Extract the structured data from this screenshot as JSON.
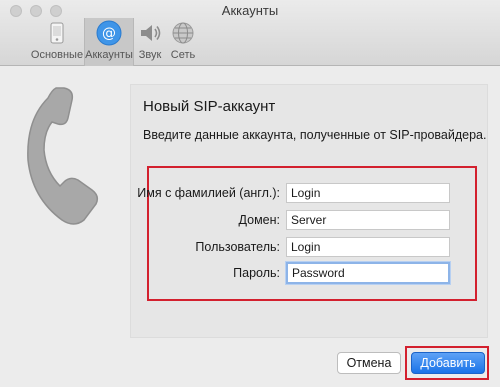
{
  "window": {
    "title": "Аккаунты"
  },
  "toolbar": {
    "items": [
      {
        "label": "Основные",
        "icon": "general-icon"
      },
      {
        "label": "Аккаунты",
        "icon": "at-icon"
      },
      {
        "label": "Звук",
        "icon": "speaker-icon"
      },
      {
        "label": "Сеть",
        "icon": "globe-icon"
      }
    ],
    "selected": "Аккаунты"
  },
  "panel": {
    "title": "Новый SIP-аккаунт",
    "description": "Введите данные аккаунта, полученные от SIP-провайдера."
  },
  "form": {
    "fullname_label": "Имя с фамилией (англ.):",
    "fullname_value": "Login",
    "domain_label": "Домен:",
    "domain_value": "Server",
    "user_label": "Пользователь:",
    "user_value": "Login",
    "password_label": "Пароль:",
    "password_value": "Password"
  },
  "buttons": {
    "cancel": "Отмена",
    "add": "Добавить"
  },
  "colors": {
    "highlight": "#d3202e",
    "accent": "#1a73e8"
  }
}
